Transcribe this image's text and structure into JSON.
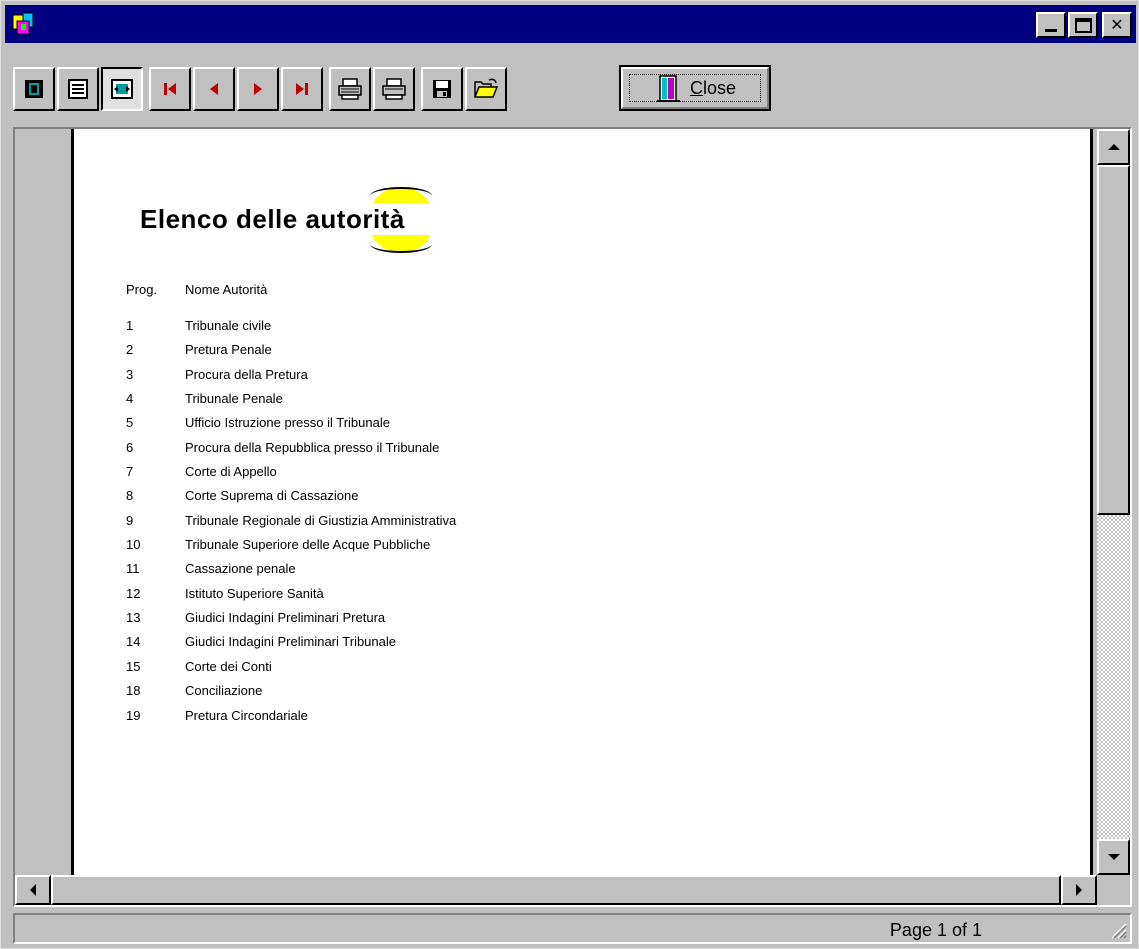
{
  "toolbar": {
    "close_label": "Close",
    "buttons": [
      "single-page-view-icon",
      "multi-page-view-icon",
      "fit-page-view-icon",
      "first-page-icon",
      "previous-page-icon",
      "next-page-icon",
      "last-page-icon",
      "print-setup-icon",
      "print-icon",
      "save-icon",
      "open-icon"
    ]
  },
  "report": {
    "title": "Elenco delle autorità",
    "header": {
      "prog": "Prog.",
      "name": "Nome Autorità"
    },
    "rows": [
      {
        "n": "1",
        "name": "Tribunale civile"
      },
      {
        "n": "2",
        "name": "Pretura Penale"
      },
      {
        "n": "3",
        "name": "Procura della Pretura"
      },
      {
        "n": "4",
        "name": "Tribunale Penale"
      },
      {
        "n": "5",
        "name": "Ufficio Istruzione presso il Tribunale"
      },
      {
        "n": "6",
        "name": "Procura della Repubblica presso il Tribunale"
      },
      {
        "n": "7",
        "name": "Corte di Appello"
      },
      {
        "n": "8",
        "name": "Corte Suprema di Cassazione"
      },
      {
        "n": "9",
        "name": "Tribunale Regionale di Giustizia Amministrativa"
      },
      {
        "n": "10",
        "name": "Tribunale Superiore delle Acque Pubbliche"
      },
      {
        "n": "11",
        "name": "Cassazione penale"
      },
      {
        "n": "12",
        "name": "Istituto Superiore Sanità"
      },
      {
        "n": "13",
        "name": "Giudici Indagini Preliminari Pretura"
      },
      {
        "n": "14",
        "name": "Giudici Indagini Preliminari Tribunale"
      },
      {
        "n": "15",
        "name": "Corte dei Conti"
      },
      {
        "n": "18",
        "name": "Conciliazione"
      },
      {
        "n": "19",
        "name": "Pretura Circondariale"
      }
    ]
  },
  "status": {
    "page": "Page 1 of 1"
  },
  "colors": {
    "titlebar": "#000080",
    "face": "#c0c0c0",
    "accent": "#ffff00",
    "nav_arrow": "#c00000"
  }
}
